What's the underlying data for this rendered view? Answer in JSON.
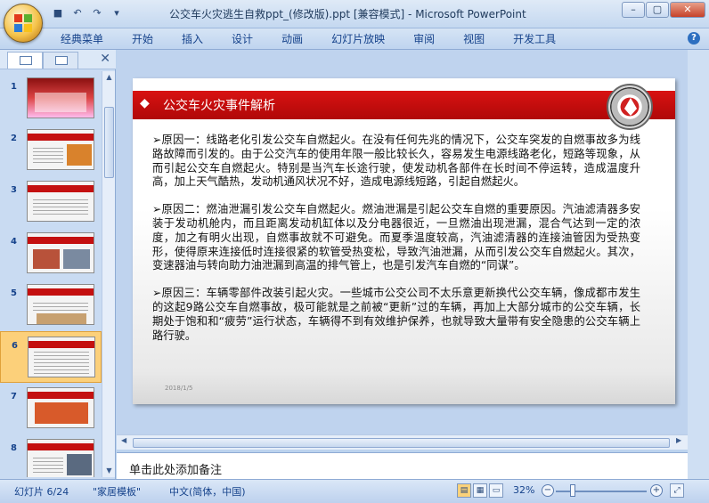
{
  "window": {
    "title": "公交车火灾逃生自救ppt_(修改版).ppt [兼容模式] - Microsoft PowerPoint",
    "controls": [
      "–",
      "▢",
      "✕"
    ]
  },
  "ribbon": {
    "tabs": [
      "经典菜单",
      "开始",
      "插入",
      "设计",
      "动画",
      "幻灯片放映",
      "审阅",
      "视图",
      "开发工具"
    ],
    "help": "?"
  },
  "thumbnails": {
    "numbers": [
      "1",
      "2",
      "3",
      "4",
      "5",
      "6",
      "7",
      "8"
    ],
    "selected": 6
  },
  "slide": {
    "title": "公交车火灾事件解析",
    "diamond": "◆",
    "paragraphs": [
      "➢原因一：线路老化引发公交车自燃起火。在没有任何先兆的情况下，公交车突发的自燃事故多为线路故障而引发的。由于公交汽车的使用年限一般比较长久，容易发生电源线路老化，短路等现象，从而引起公交车自燃起火。特别是当汽车长途行驶，使发动机各部件在长时间不停运转，造成温度升高，加上天气酷热，发动机通风状况不好，造成电源线短路，引起自燃起火。",
      "➢原因二：燃油泄漏引发公交车自燃起火。燃油泄漏是引起公交车自燃的重要原因。汽油滤清器多安装于发动机舱内，而且距离发动机缸体以及分电器很近，一旦燃油出现泄漏，混合气达到一定的浓度，加之有明火出现，自燃事故就不可避免。而夏季温度较高，汽油滤清器的连接油管因为受热变形，使得原来连接低时连接很紧的软管受热变松，导致汽油泄漏，从而引发公交车自燃起火。其次，变速器油与转向助力油泄漏到高温的排气管上，也是引发汽车自燃的“同谋”。",
      "➢原因三：车辆零部件改装引起火灾。一些城市公交公司不太乐意更新换代公交车辆，像成都市发生的这起9路公交车自燃事故，极可能就是之前被“更新”过的车辆，再加上大部分城市的公交车辆，长期处于饱和和“疲劳”运行状态，车辆得不到有效维护保养，也就导致大量带有安全隐患的公交车辆上路行驶。"
    ],
    "date": "2018/1/5"
  },
  "notes": {
    "placeholder": "单击此处添加备注"
  },
  "status": {
    "slide_info": "幻灯片 6/24",
    "theme": "\"家居模板\"",
    "language": "中文(简体，中国)",
    "zoom": "32%",
    "zoom_out": "−",
    "zoom_in": "+"
  }
}
